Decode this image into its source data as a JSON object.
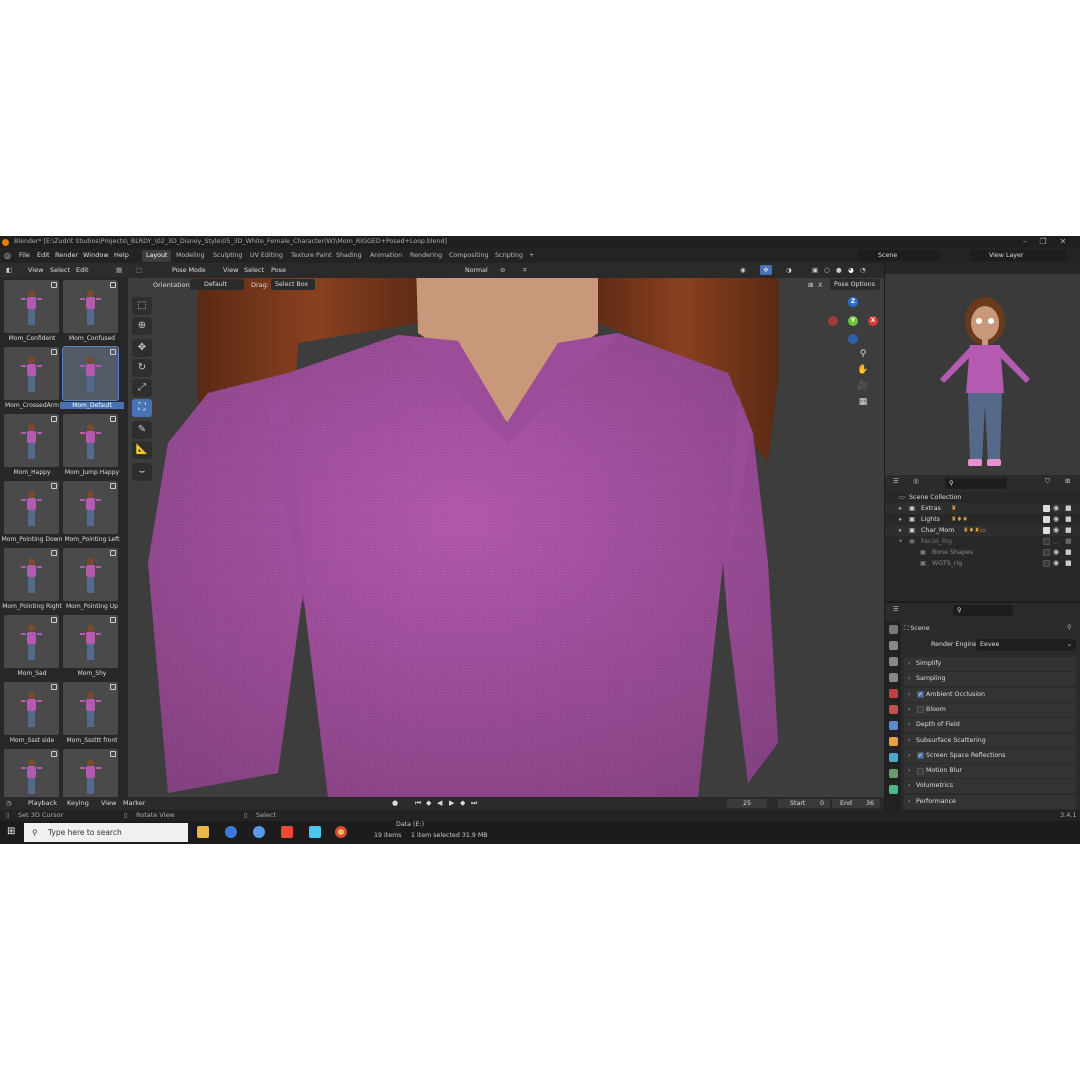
{
  "window": {
    "title": "Blender* [E:\\Zudrit Studios\\Projects\\_BLRDY_\\02_3D_Disney_Style\\05_3D_White_Female_Character(W)\\Mom_RIGGED+Posed+Loop.blend]",
    "controls": [
      "–",
      "❐",
      "✕"
    ]
  },
  "menubar": {
    "menus": [
      "File",
      "Edit",
      "Render",
      "Window",
      "Help"
    ],
    "workspaces": [
      "Layout",
      "Modeling",
      "Sculpting",
      "UV Editing",
      "Texture Paint",
      "Shading",
      "Animation",
      "Rendering",
      "Compositing",
      "Scripting"
    ],
    "add_tab": "+",
    "scene": "Scene",
    "view_layer": "View Layer"
  },
  "asset_panel": {
    "menus": [
      "View",
      "Select",
      "Edit"
    ],
    "items": [
      {
        "label": "Mom_Confident"
      },
      {
        "label": "Mom_Confused"
      },
      {
        "label": "Mom_CrossedArm"
      },
      {
        "label": "Mom_Default"
      },
      {
        "label": "Mom_Happy"
      },
      {
        "label": "Mom_Jump Happy"
      },
      {
        "label": "Mom_Pointing Down"
      },
      {
        "label": "Mom_Pointing Left"
      },
      {
        "label": "Mom_Pointing Right"
      },
      {
        "label": "Mom_Pointing Up"
      },
      {
        "label": "Mom_Sad"
      },
      {
        "label": "Mom_Shy"
      },
      {
        "label": "Mom_Ssst side"
      },
      {
        "label": "Mom_Sssttt front"
      },
      {
        "label": ""
      },
      {
        "label": ""
      }
    ],
    "selected_index": 3
  },
  "viewport": {
    "mode": "Pose Mode",
    "menus": [
      "View",
      "Select",
      "Pose"
    ],
    "pivot": "Normal",
    "orientation_label": "Orientation:",
    "orientation_value": "Default",
    "drag_label": "Drag:",
    "drag_value": "Select Box",
    "pose_options": "Pose Options",
    "axis_labels": {
      "x": "X",
      "y": "Y",
      "z": "Z"
    },
    "colors": {
      "shirt": "#b45ab0",
      "hair": "#7a3a1c",
      "skin": "#c9987a",
      "background": "#3d3d3d"
    }
  },
  "outliner": {
    "rows": [
      {
        "name": "Scene Collection"
      },
      {
        "name": "Extras"
      },
      {
        "name": "Lights"
      },
      {
        "name": "Char_Mom"
      },
      {
        "name": "Facial_Rig"
      },
      {
        "name": "Bone Shapes"
      },
      {
        "name": "WGTS_rig"
      }
    ]
  },
  "properties": {
    "context": "Scene",
    "render_engine_label": "Render Engine",
    "render_engine": "Eevee",
    "panels": [
      {
        "label": "Simplify",
        "checkbox": null
      },
      {
        "label": "Sampling",
        "checkbox": null
      },
      {
        "label": "Ambient Occlusion",
        "checkbox": true
      },
      {
        "label": "Bloom",
        "checkbox": false
      },
      {
        "label": "Depth of Field",
        "checkbox": null
      },
      {
        "label": "Subsurface Scattering",
        "checkbox": null
      },
      {
        "label": "Screen Space Reflections",
        "checkbox": true
      },
      {
        "label": "Motion Blur",
        "checkbox": false
      },
      {
        "label": "Volumetrics",
        "checkbox": null
      },
      {
        "label": "Performance",
        "checkbox": null
      }
    ]
  },
  "timeline": {
    "menus": [
      "Playback",
      "Keying",
      "View",
      "Marker"
    ],
    "current_frame": "25",
    "start_label": "Start",
    "start": "0",
    "end_label": "End",
    "end": "36"
  },
  "statusbar": {
    "left": "Set 3D Cursor",
    "middle": "Rotate View",
    "right": "Select",
    "version": "3.4.1"
  },
  "taskbar": {
    "search_placeholder": "Type here to search",
    "explorer_path": "Data (E:)",
    "explorer_items": "19 items",
    "explorer_selected": "1 item selected  31.9 MB"
  }
}
